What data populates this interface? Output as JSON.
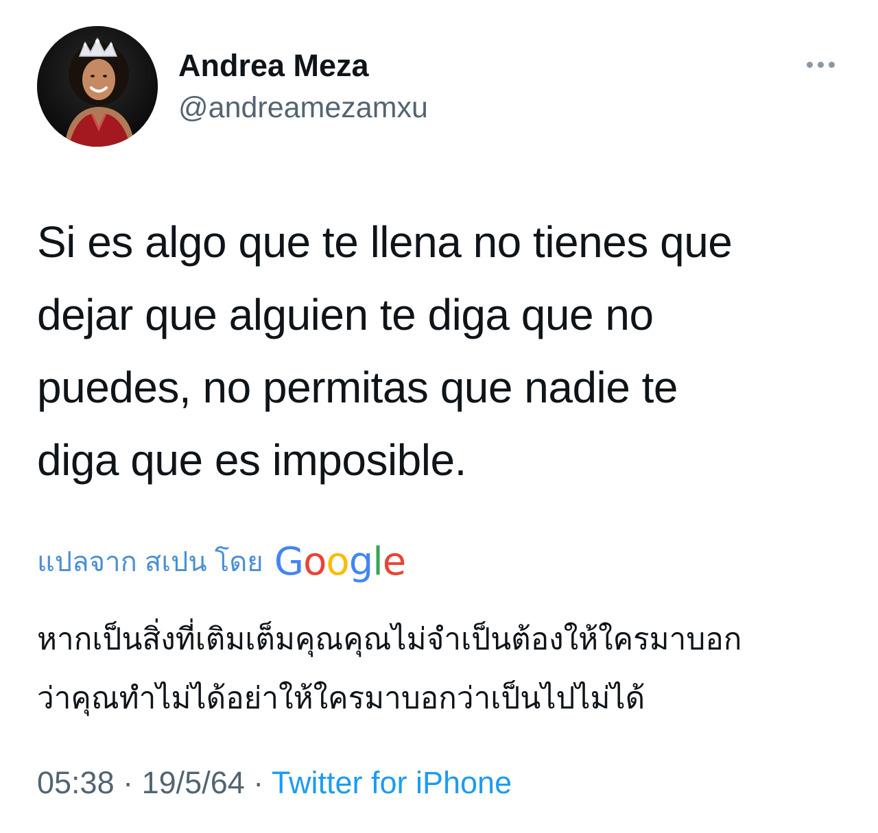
{
  "author": {
    "display_name": "Andrea Meza",
    "handle": "@andreamezamxu"
  },
  "tweet": {
    "text_lines": [
      "Si es algo que te llena no tienes que",
      "dejar que alguien te diga que no",
      "puedes, no permitas que nadie te",
      "diga que es imposible."
    ]
  },
  "translation": {
    "label": "แปลจาก สเปน โดย",
    "provider": "Google",
    "provider_letters": [
      "G",
      "o",
      "o",
      "g",
      "l",
      "e"
    ],
    "provider_colors": [
      "#4285F4",
      "#EA4335",
      "#FBBC05",
      "#4285F4",
      "#34A853",
      "#EA4335"
    ],
    "text_lines": [
      "หากเป็นสิ่งที่เติมเต็มคุณคุณไม่จำเป็นต้องให้ใครมาบอก",
      "ว่าคุณทำไม่ได้อย่าให้ใครมาบอกว่าเป็นไปไม่ได้"
    ]
  },
  "meta": {
    "time": "05:38",
    "separator": " · ",
    "date": "19/5/64",
    "source": "Twitter for iPhone"
  },
  "colors": {
    "text": "#0f1419",
    "secondary": "#536471",
    "link": "#1d9bf0",
    "translate_label": "#4a8fd6"
  },
  "icons": {
    "more": "more-horizontal-icon",
    "avatar": "profile-photo"
  }
}
